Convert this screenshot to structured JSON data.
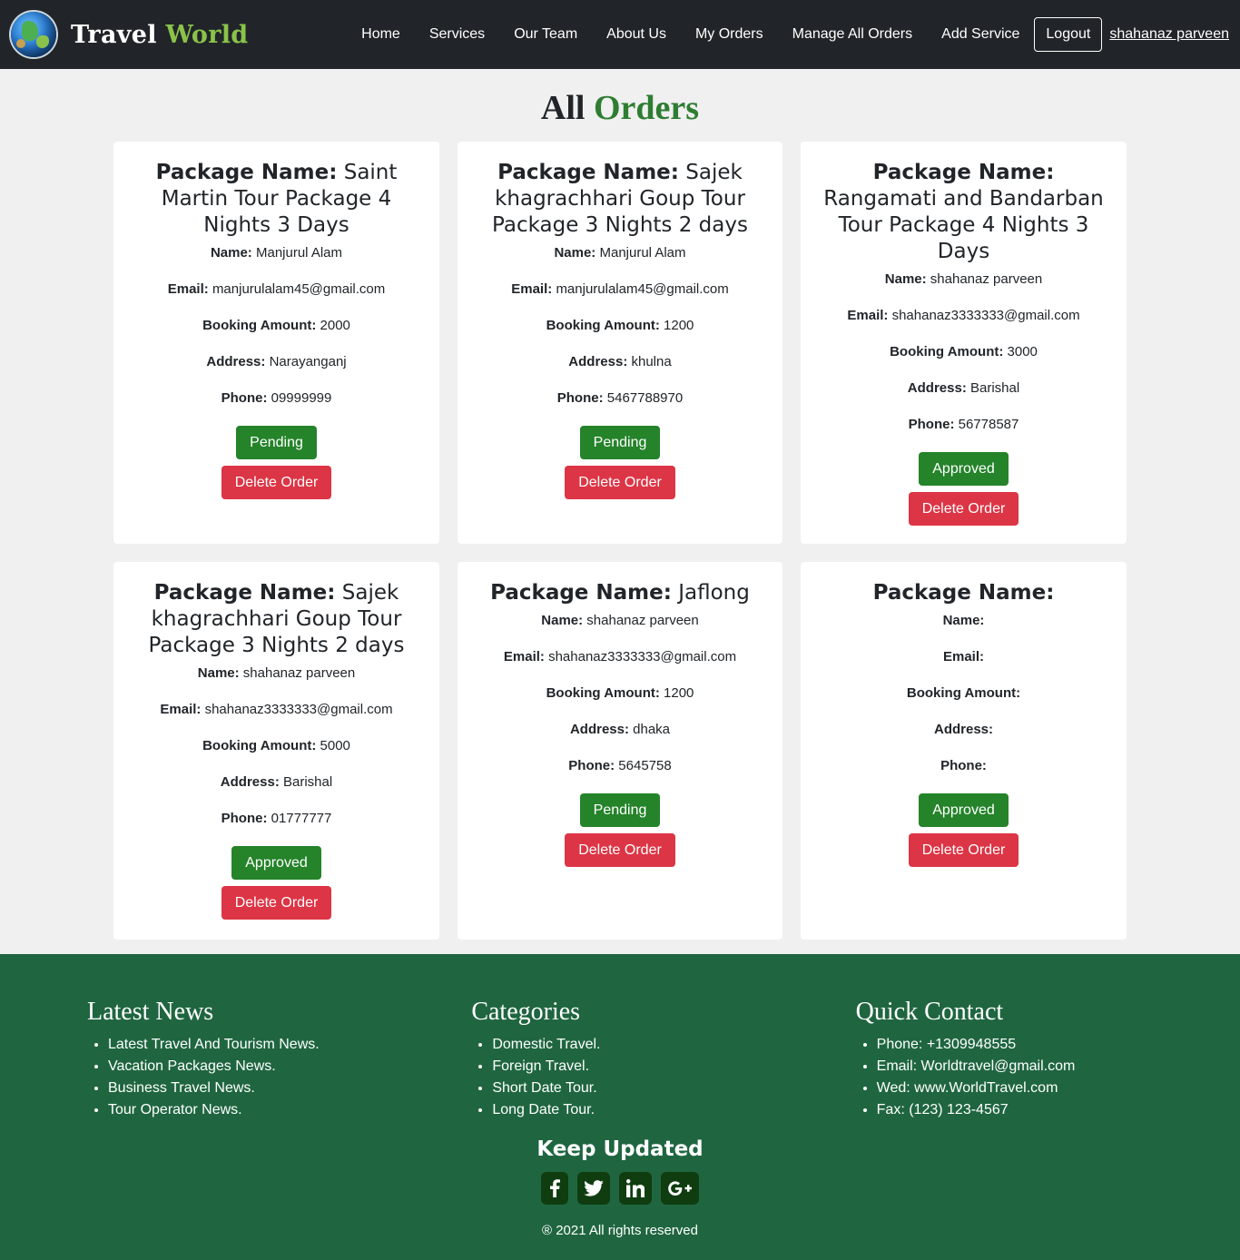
{
  "brand": {
    "word1": "Travel",
    "word2": "World",
    "logo_icon": "globe-icon"
  },
  "nav": {
    "links": [
      "Home",
      "Services",
      "Our Team",
      "About Us",
      "My Orders",
      "Manage All Orders",
      "Add Service"
    ],
    "logout_label": "Logout",
    "user_name": "shahanaz parveen"
  },
  "page": {
    "title_part1": "All",
    "title_part2": "Orders"
  },
  "labels": {
    "package": "Package Name:",
    "name": "Name:",
    "email": "Email:",
    "amount": "Booking Amount:",
    "address": "Address:",
    "phone": "Phone:",
    "delete": "Delete Order"
  },
  "orders": [
    {
      "package": "Saint Martin Tour Package 4 Nights 3 Days",
      "name": "Manjurul Alam",
      "email": "manjurulalam45@gmail.com",
      "amount": "2000",
      "address": "Narayanganj",
      "phone": "09999999",
      "status": "Pending"
    },
    {
      "package": "Sajek khagrachhari Goup Tour Package 3 Nights 2 days",
      "name": "Manjurul Alam",
      "email": "manjurulalam45@gmail.com",
      "amount": "1200",
      "address": "khulna",
      "phone": "5467788970",
      "status": "Pending"
    },
    {
      "package": "Rangamati and Bandarban Tour Package 4 Nights 3 Days",
      "name": "shahanaz parveen",
      "email": "shahanaz3333333@gmail.com",
      "amount": "3000",
      "address": "Barishal",
      "phone": "56778587",
      "status": "Approved"
    },
    {
      "package": "Sajek khagrachhari Goup Tour Package 3 Nights 2 days",
      "name": "shahanaz parveen",
      "email": "shahanaz3333333@gmail.com",
      "amount": "5000",
      "address": "Barishal",
      "phone": "01777777",
      "status": "Approved"
    },
    {
      "package": "Jaflong",
      "name": "shahanaz parveen",
      "email": "shahanaz3333333@gmail.com",
      "amount": "1200",
      "address": "dhaka",
      "phone": "5645758",
      "status": "Pending"
    },
    {
      "package": "",
      "name": "",
      "email": "",
      "amount": "",
      "address": "",
      "phone": "",
      "status": "Approved"
    }
  ],
  "footer": {
    "latest_news": {
      "title": "Latest News",
      "items": [
        "Latest Travel And Tourism News.",
        "Vacation Packages News.",
        "Business Travel News.",
        "Tour Operator News."
      ]
    },
    "categories": {
      "title": "Categories",
      "items": [
        "Domestic Travel.",
        "Foreign Travel.",
        "Short Date Tour.",
        "Long Date Tour."
      ]
    },
    "quick_contact": {
      "title": "Quick Contact",
      "items": [
        "Phone: +1309948555",
        "Email: Worldtravel@gmail.com",
        "Wed: www.WorldTravel.com",
        "Fax: (123) 123-4567"
      ]
    },
    "keep_updated": "Keep Updated",
    "socials": [
      "facebook-icon",
      "twitter-icon",
      "linkedin-icon",
      "google-plus-icon"
    ],
    "copyright": "® 2021 All rights reserved"
  },
  "colors": {
    "navbar": "#212529",
    "accent_green": "#25832a",
    "delete_red": "#dc3545",
    "footer_bg": "#1f6640",
    "brand_green": "#8bc34a"
  }
}
